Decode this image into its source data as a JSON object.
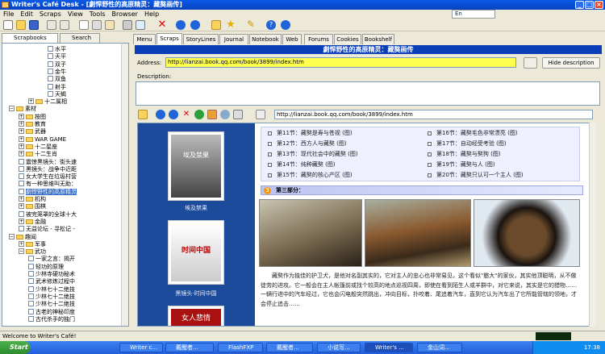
{
  "window": {
    "title": "Writer's Café Desk - [劇悍野性的高原精灵：藏獒画传]",
    "min": "_",
    "max": "□",
    "close": "×"
  },
  "menubar": {
    "items": [
      "File",
      "Edit",
      "Scraps",
      "View",
      "Tools",
      "Browser",
      "Help"
    ]
  },
  "lang_indicator": "En",
  "left_tabs": [
    "Scrapbooks",
    "Search"
  ],
  "tree": {
    "items": [
      {
        "label": "水平",
        "level": 5,
        "kind": "doc"
      },
      {
        "label": "天平",
        "level": 5,
        "kind": "doc"
      },
      {
        "label": "双子",
        "level": 5,
        "kind": "doc"
      },
      {
        "label": "金牛",
        "level": 5,
        "kind": "doc"
      },
      {
        "label": "双鱼",
        "level": 5,
        "kind": "doc"
      },
      {
        "label": "射手",
        "level": 5,
        "kind": "doc"
      },
      {
        "label": "天蝎",
        "level": 5,
        "kind": "doc"
      },
      {
        "label": "十二属相",
        "level": 3,
        "kind": "folder",
        "pm": "+"
      },
      {
        "label": "素材",
        "level": 1,
        "kind": "folder",
        "pm": "−"
      },
      {
        "label": "按图",
        "level": 2,
        "kind": "folder",
        "pm": "+"
      },
      {
        "label": "教育",
        "level": 2,
        "kind": "folder",
        "pm": "+"
      },
      {
        "label": "武器",
        "level": 2,
        "kind": "folder",
        "pm": "+"
      },
      {
        "label": "WAR GAME",
        "level": 2,
        "kind": "folder",
        "pm": "+"
      },
      {
        "label": "十二星座",
        "level": 2,
        "kind": "folder",
        "pm": "+"
      },
      {
        "label": "十二生肖",
        "level": 2,
        "kind": "folder",
        "pm": "+"
      },
      {
        "label": "震惊黑镜头：街头速",
        "level": 2,
        "kind": "doc"
      },
      {
        "label": "黑镜头：战争中近距",
        "level": 2,
        "kind": "doc"
      },
      {
        "label": "女大学生在垃圾村营",
        "level": 2,
        "kind": "doc"
      },
      {
        "label": "有一种思维叫无助：",
        "level": 2,
        "kind": "doc"
      },
      {
        "label": "劇悍野性的高原精灵",
        "level": 2,
        "kind": "doc",
        "selected": true
      },
      {
        "label": "机构",
        "level": 2,
        "kind": "folder",
        "pm": "+"
      },
      {
        "label": "围棋",
        "level": 2,
        "kind": "folder",
        "pm": "+"
      },
      {
        "label": "被完笼罩的全球十大",
        "level": 2,
        "kind": "doc"
      },
      {
        "label": "金融",
        "level": 2,
        "kind": "folder",
        "pm": "+"
      },
      {
        "label": "无益论坛 - 寻松记 - ",
        "level": 2,
        "kind": "doc"
      },
      {
        "label": "趣闻",
        "level": 1,
        "kind": "folder",
        "pm": "−"
      },
      {
        "label": "军事",
        "level": 2,
        "kind": "folder",
        "pm": "+"
      },
      {
        "label": "武功",
        "level": 2,
        "kind": "folder",
        "pm": "−"
      },
      {
        "label": "一家之言：揭开",
        "level": 3,
        "kind": "doc"
      },
      {
        "label": "轻功的原理",
        "level": 3,
        "kind": "doc"
      },
      {
        "label": "少林寺硬功秘术",
        "level": 3,
        "kind": "doc"
      },
      {
        "label": "武术修炼过程中",
        "level": 3,
        "kind": "doc"
      },
      {
        "label": "少林七十二绝技",
        "level": 3,
        "kind": "doc"
      },
      {
        "label": "少林七十二绝技",
        "level": 3,
        "kind": "doc"
      },
      {
        "label": "少林七十二绝技",
        "level": 3,
        "kind": "doc"
      },
      {
        "label": "古老的神秘印度",
        "level": 3,
        "kind": "doc"
      },
      {
        "label": "古代杀手的独门",
        "level": 3,
        "kind": "doc"
      }
    ]
  },
  "main_tabs": [
    "Menu",
    "Scraps",
    "StoryLines",
    "Journal",
    "Notebook",
    "Web",
    "Forums",
    "Cookies",
    "Bookshelf"
  ],
  "active_tab": "Scraps",
  "scrap_title": "劇悍野性的高原精灵：藏獒画传",
  "address": {
    "label": "Address:",
    "value": "http://lianzai.book.qq.com/book/3899/index.htm"
  },
  "hide_description": "Hide description",
  "description_label": "Description:",
  "browser_url": "http://lianzai.book.qq.com/book/3899/index.htm",
  "web": {
    "books": [
      {
        "caption": "埃及禁果",
        "cover": "埃及禁果"
      },
      {
        "caption": "黑镜头·时间中国",
        "cover": "时间中国"
      },
      {
        "caption": "",
        "cover": "女人悲情"
      }
    ],
    "chapters_left": [
      "第11节：藏獒是寿与苍视 (图)",
      "第12节：西方人与藏獒 (图)",
      "第13节：现代社会中的藏獒 (图)",
      "第14节：纯种藏獒 (图)",
      "第15节：藏獒的核心产区 (图)"
    ],
    "chapters_right": [
      "第16节：藏獒毛色非常漂亮 (图)",
      "第17节：自动经受考验 (图)",
      "第18节：藏獒与獒狗 (图)",
      "第19节：藏獒与人 (图)",
      "第20节：藏獒只认可一个主人 (图)"
    ],
    "part_num": "3",
    "part_title": "第三部分：",
    "paragraph": "藏獒作为独佳的护卫犬，是他对名副其实的，它对主人的忠心也非常易见，这个看似\"憨大\"的家伙，其实他顶聪明，从不做徒劳的进攻。它一般会在主人帐篷前或找个较高的地点巡视四周，即使在看到陌生人或羊群中，对它来说，其实是它的猎物……一辆行进中的汽车经过，它也会闪电般突然跳出，冲向目标，扑咬着、尾追着汽车，直到它认为汽车出了它所能管辖的领地，才会停止追击……"
  },
  "status": "Welcome to Writer's Café!",
  "taskbar": {
    "start": "Start",
    "tasks": [
      "Writer c...",
      "戴醒者...",
      "FlashFXP",
      "戴醒者...",
      "小说写...",
      "Writer's ...",
      "金山词..."
    ],
    "clock": "17:38"
  },
  "colors": {
    "title_blue": "#0a5ae8",
    "header_blue": "#0a3eb8",
    "address_yellow": "#ffff50",
    "sidebar_blue": "#1b4b9a"
  }
}
